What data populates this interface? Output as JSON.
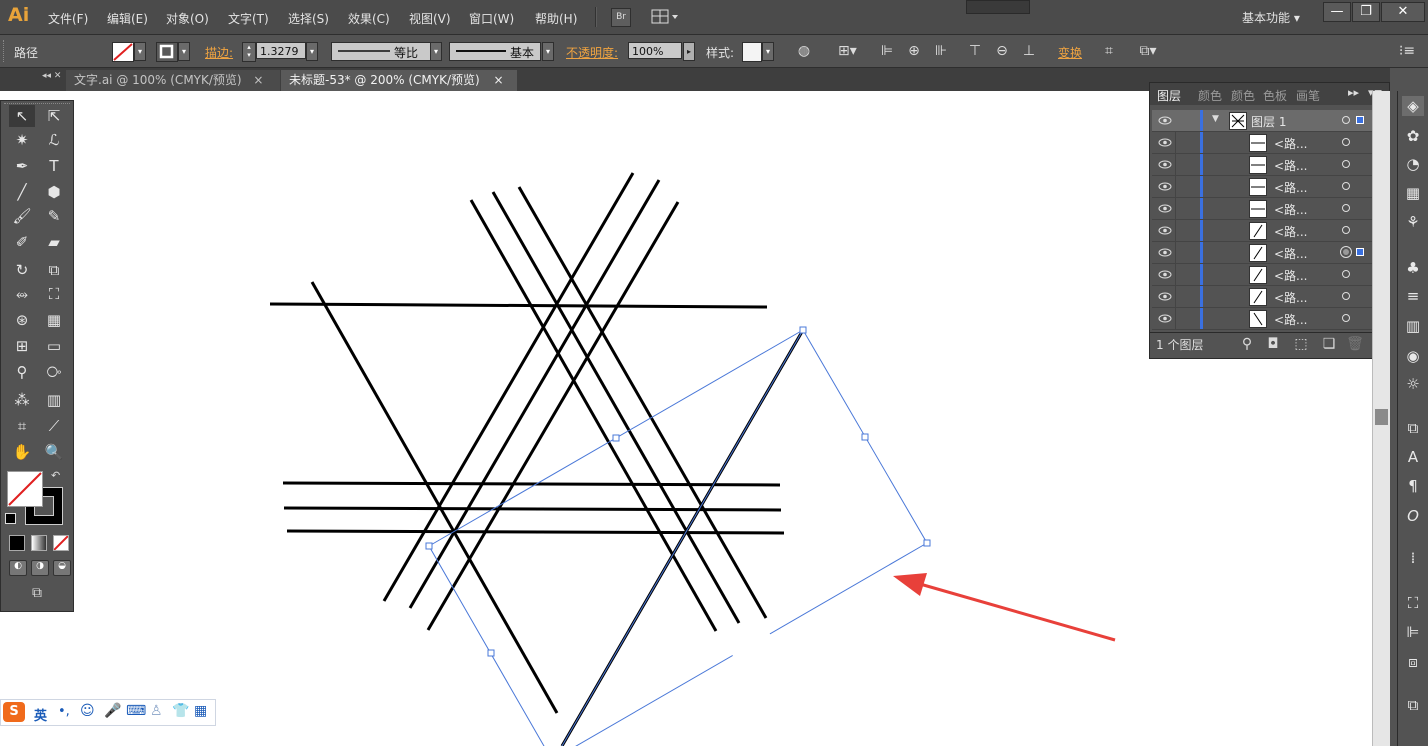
{
  "app": {
    "logo": "Ai",
    "workspace": "基本功能",
    "br_label": "Br"
  },
  "menu": [
    "文件(F)",
    "编辑(E)",
    "对象(O)",
    "文字(T)",
    "选择(S)",
    "效果(C)",
    "视图(V)",
    "窗口(W)",
    "帮助(H)"
  ],
  "window_controls": {
    "minimize": "—",
    "restore": "❐",
    "close": "✕"
  },
  "control_bar": {
    "object_type": "路径",
    "stroke_label": "描边:",
    "stroke_weight": "1.3279",
    "profile": "等比",
    "brush": "基本",
    "opacity_label": "不透明度:",
    "opacity": "100%",
    "style_label": "样式:",
    "transform_label": "变换"
  },
  "tabs": [
    {
      "label": "文字.ai @ 100% (CMYK/预览)",
      "close": "×",
      "active": false
    },
    {
      "label": "未标题-53* @ 200% (CMYK/预览)",
      "close": "×",
      "active": true
    }
  ],
  "layers_panel": {
    "tabs": [
      "图层",
      "颜色",
      "颜色",
      "色板",
      "画笔"
    ],
    "layer_name": "图层 1",
    "rows": [
      {
        "name": "<路...",
        "thumb": "h"
      },
      {
        "name": "<路...",
        "thumb": "h"
      },
      {
        "name": "<路...",
        "thumb": "h"
      },
      {
        "name": "<路...",
        "thumb": "h"
      },
      {
        "name": "<路...",
        "thumb": "d"
      },
      {
        "name": "<路...",
        "thumb": "d",
        "selected": true
      },
      {
        "name": "<路...",
        "thumb": "d"
      },
      {
        "name": "<路...",
        "thumb": "d"
      },
      {
        "name": "<路...",
        "thumb": "b"
      }
    ],
    "footer": "1 个图层"
  },
  "ime": {
    "mode": "英"
  },
  "colors": {
    "accent": "#e8a33a",
    "selection": "#4a78d8",
    "arrow": "#e8403a"
  }
}
